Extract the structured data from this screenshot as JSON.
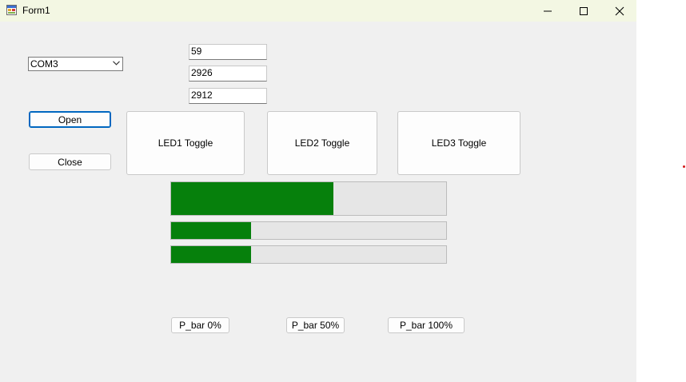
{
  "window": {
    "title": "Form1",
    "icon": "winforms-app-icon",
    "controls": {
      "minimize": "minimize-icon",
      "maximize": "maximize-icon",
      "close": "close-icon"
    }
  },
  "port": {
    "selected": "COM3"
  },
  "readouts": [
    "59",
    "2926",
    "2912"
  ],
  "buttons": {
    "open": "Open",
    "close": "Close",
    "led1": "LED1 Toggle",
    "led2": "LED2 Toggle",
    "led3": "LED3 Toggle",
    "pbar0": "P_bar 0%",
    "pbar50": "P_bar 50%",
    "pbar100": "P_bar 100%"
  },
  "progress": [
    0.59,
    0.29,
    0.29
  ],
  "colors": {
    "progress_fill": "#06800c",
    "focus_border": "#0067c0"
  }
}
